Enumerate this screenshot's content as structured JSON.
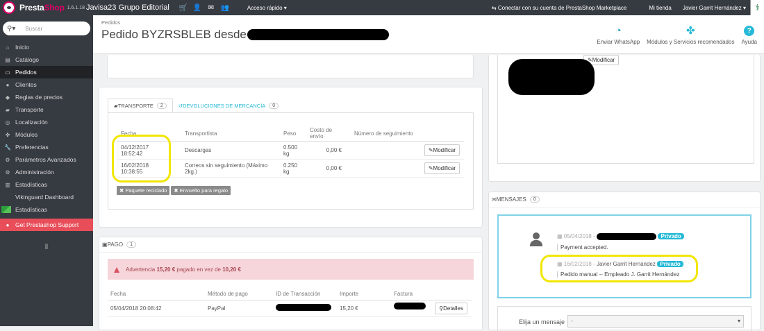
{
  "topbar": {
    "brand_presta": "Presta",
    "brand_shop": "Shop",
    "version": "1.6.1.18",
    "shop_name": "Javisa23 Grupo Editorial",
    "quick_access": "Acceso rápido ▾",
    "connect": "Conectar con su cuenta de PrestaShop Marketplace",
    "my_shop": "Mi tienda",
    "user": "Javier Garrit Hernández ▾"
  },
  "search": {
    "placeholder": "Buscar"
  },
  "sidebar": {
    "items": [
      {
        "label": "Inicio",
        "icon": "home-icon"
      },
      {
        "label": "Catálogo",
        "icon": "book-icon"
      },
      {
        "label": "Pedidos",
        "icon": "credit-card-icon"
      },
      {
        "label": "Clientes",
        "icon": "user-icon"
      },
      {
        "label": "Reglas de precios",
        "icon": "tag-icon"
      },
      {
        "label": "Transporte",
        "icon": "truck-icon"
      },
      {
        "label": "Localización",
        "icon": "globe-icon"
      },
      {
        "label": "Módulos",
        "icon": "puzzle-icon"
      },
      {
        "label": "Preferencias",
        "icon": "wrench-icon"
      },
      {
        "label": "Parámetros Avanzados",
        "icon": "cogs-icon"
      },
      {
        "label": "Administración",
        "icon": "gear-icon"
      },
      {
        "label": "Estadísticas",
        "icon": "bar-chart-icon"
      },
      {
        "label": "Vikinguard Dashboard",
        "icon": ""
      },
      {
        "label": "Estadísticas",
        "icon": "stats-chart-icon"
      },
      {
        "label": "Get Prestashop Support",
        "icon": "support-icon"
      }
    ]
  },
  "header": {
    "breadcrumb": "Pedidos",
    "title": "Pedido BYZRSBLEB desde",
    "whatsapp": "Enviar WhatsApp",
    "modules": "Módulos y Servicios recomendados",
    "help": "Ayuda"
  },
  "shipping": {
    "tab_transport": "TRANSPORTE",
    "tab_transport_count": "2",
    "tab_returns": "DEVOLUCIONES DE MERCANCÍA",
    "tab_returns_count": "0",
    "headers": [
      "Fecha",
      "Transportista",
      "Peso",
      "Costo de envío",
      "Número de seguimiento"
    ],
    "rows": [
      {
        "date": "04/12/2017",
        "time": "18:52:42",
        "carrier": "Descargas",
        "weight": "0.500",
        "unit": "kg",
        "cost": "0,00 €",
        "action": "Modificar"
      },
      {
        "date": "16/02/2018",
        "time": "10:38:55",
        "carrier": "Correos sin seguimiento (Máximo",
        "carrier2": "2kg.)",
        "weight": "0.250",
        "unit": "kg",
        "cost": "0,00 €",
        "action": "Modificar"
      }
    ],
    "tag_recycled": "Paquete reciclado",
    "tag_gift": "Envuelto para regalo"
  },
  "payment": {
    "title": "PAGO",
    "count": "1",
    "warn_prefix": "Advertencia ",
    "warn_amount": "15,20 €",
    "warn_mid": " pagado en vez de ",
    "warn_total": "10,20 €",
    "headers": [
      "Fecha",
      "Método de pago",
      "ID de Transacción",
      "Importe",
      "Factura"
    ],
    "row": {
      "date": "05/04/2018 20:08:42",
      "method": "PayPal",
      "amount": "15,20 €",
      "action": "Detalles"
    }
  },
  "right": {
    "modify": "Modificar"
  },
  "messages": {
    "title": "MENSAJES",
    "count": "0",
    "m1": {
      "date": "05/04/2018",
      "badge": "Privado",
      "text": "Payment accepted."
    },
    "m2": {
      "date": "16/02/2018",
      "author": "Javier Garrit Hernández",
      "badge": "Privado",
      "text": "Pedido manual -- Empleado J. Garrit Hernández"
    },
    "choose_label": "Elija un mensaje",
    "choose_value": "-"
  }
}
